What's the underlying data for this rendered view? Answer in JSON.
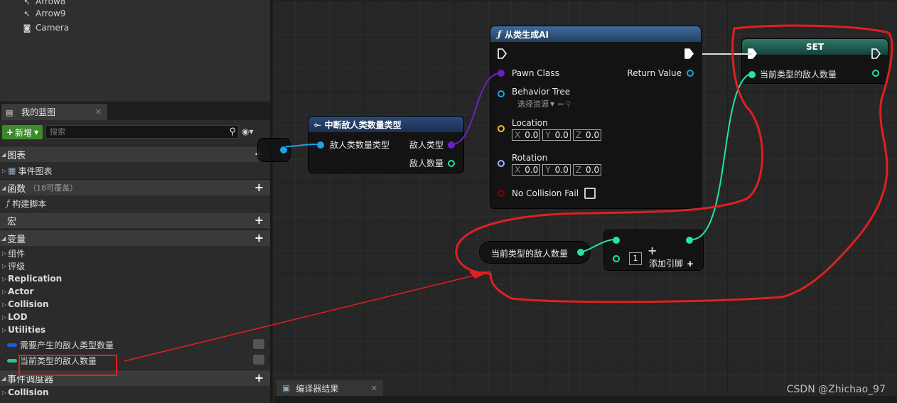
{
  "components": {
    "items": [
      {
        "label": "Arrow8",
        "icon": "arrow-icon"
      },
      {
        "label": "Arrow9",
        "icon": "arrow-icon"
      },
      {
        "label": "Camera",
        "icon": "camera-icon"
      }
    ]
  },
  "mybp": {
    "tab_label": "我的蓝图",
    "new_label": "新增",
    "search_placeholder": "搜索",
    "sections": {
      "graphs": "图表",
      "event_graph": "事件图表",
      "functions": "函数",
      "functions_sub": "（18可覆盖）",
      "construction_script": "构建脚本",
      "macros": "宏",
      "variables": "变量",
      "event_dispatchers": "事件调度器"
    },
    "var_categories": [
      "组件",
      "评级",
      "Replication",
      "Actor",
      "Collision",
      "LOD",
      "Utilities"
    ],
    "variables": [
      {
        "label": "需要产生的敌人类型数量",
        "color": "#1a5fd6"
      },
      {
        "label": "当前类型的敌人数量",
        "color": "#21c9a0"
      }
    ],
    "dispatcher_items": [
      "Collision"
    ]
  },
  "nodes": {
    "switch": {
      "title": "中断敌人类数量类型",
      "in_label": "敌人类数量类型",
      "out1": "敌人类型",
      "out2": "敌人数量"
    },
    "spawn": {
      "title": "从类生成AI",
      "pawn_class": "Pawn Class",
      "return_value": "Return Value",
      "behavior_tree": "Behavior Tree",
      "select_asset": "选择资源",
      "location": "Location",
      "rotation": "Rotation",
      "loc": {
        "x": "0.0",
        "y": "0.0",
        "z": "0.0"
      },
      "rot": {
        "x": "0.0",
        "y": "0.0",
        "z": "0.0"
      },
      "no_collision_fail": "No Collision Fail",
      "axis_x": "X",
      "axis_y": "Y",
      "axis_z": "Z"
    },
    "set": {
      "title": "SET",
      "var_label": "当前类型的敌人数量"
    },
    "getter": {
      "label": "当前类型的敌人数量"
    },
    "increment": {
      "value": "1",
      "add_pin": "添加引脚"
    }
  },
  "bottom": {
    "tab_label": "编译器结果"
  },
  "watermark": "CSDN @Zhichao_97",
  "colors": {
    "exec": "#ffffff",
    "class_pin": "#6e1fc9",
    "object_pin": "#1ba2e8",
    "vector_pin": "#f7c02e",
    "rotator_pin": "#a0b0ff",
    "bool_pin": "#8c0000",
    "int_pin": "#21e5a0",
    "byte_pin": "#0a6e3e",
    "annotation": "#e02020"
  }
}
